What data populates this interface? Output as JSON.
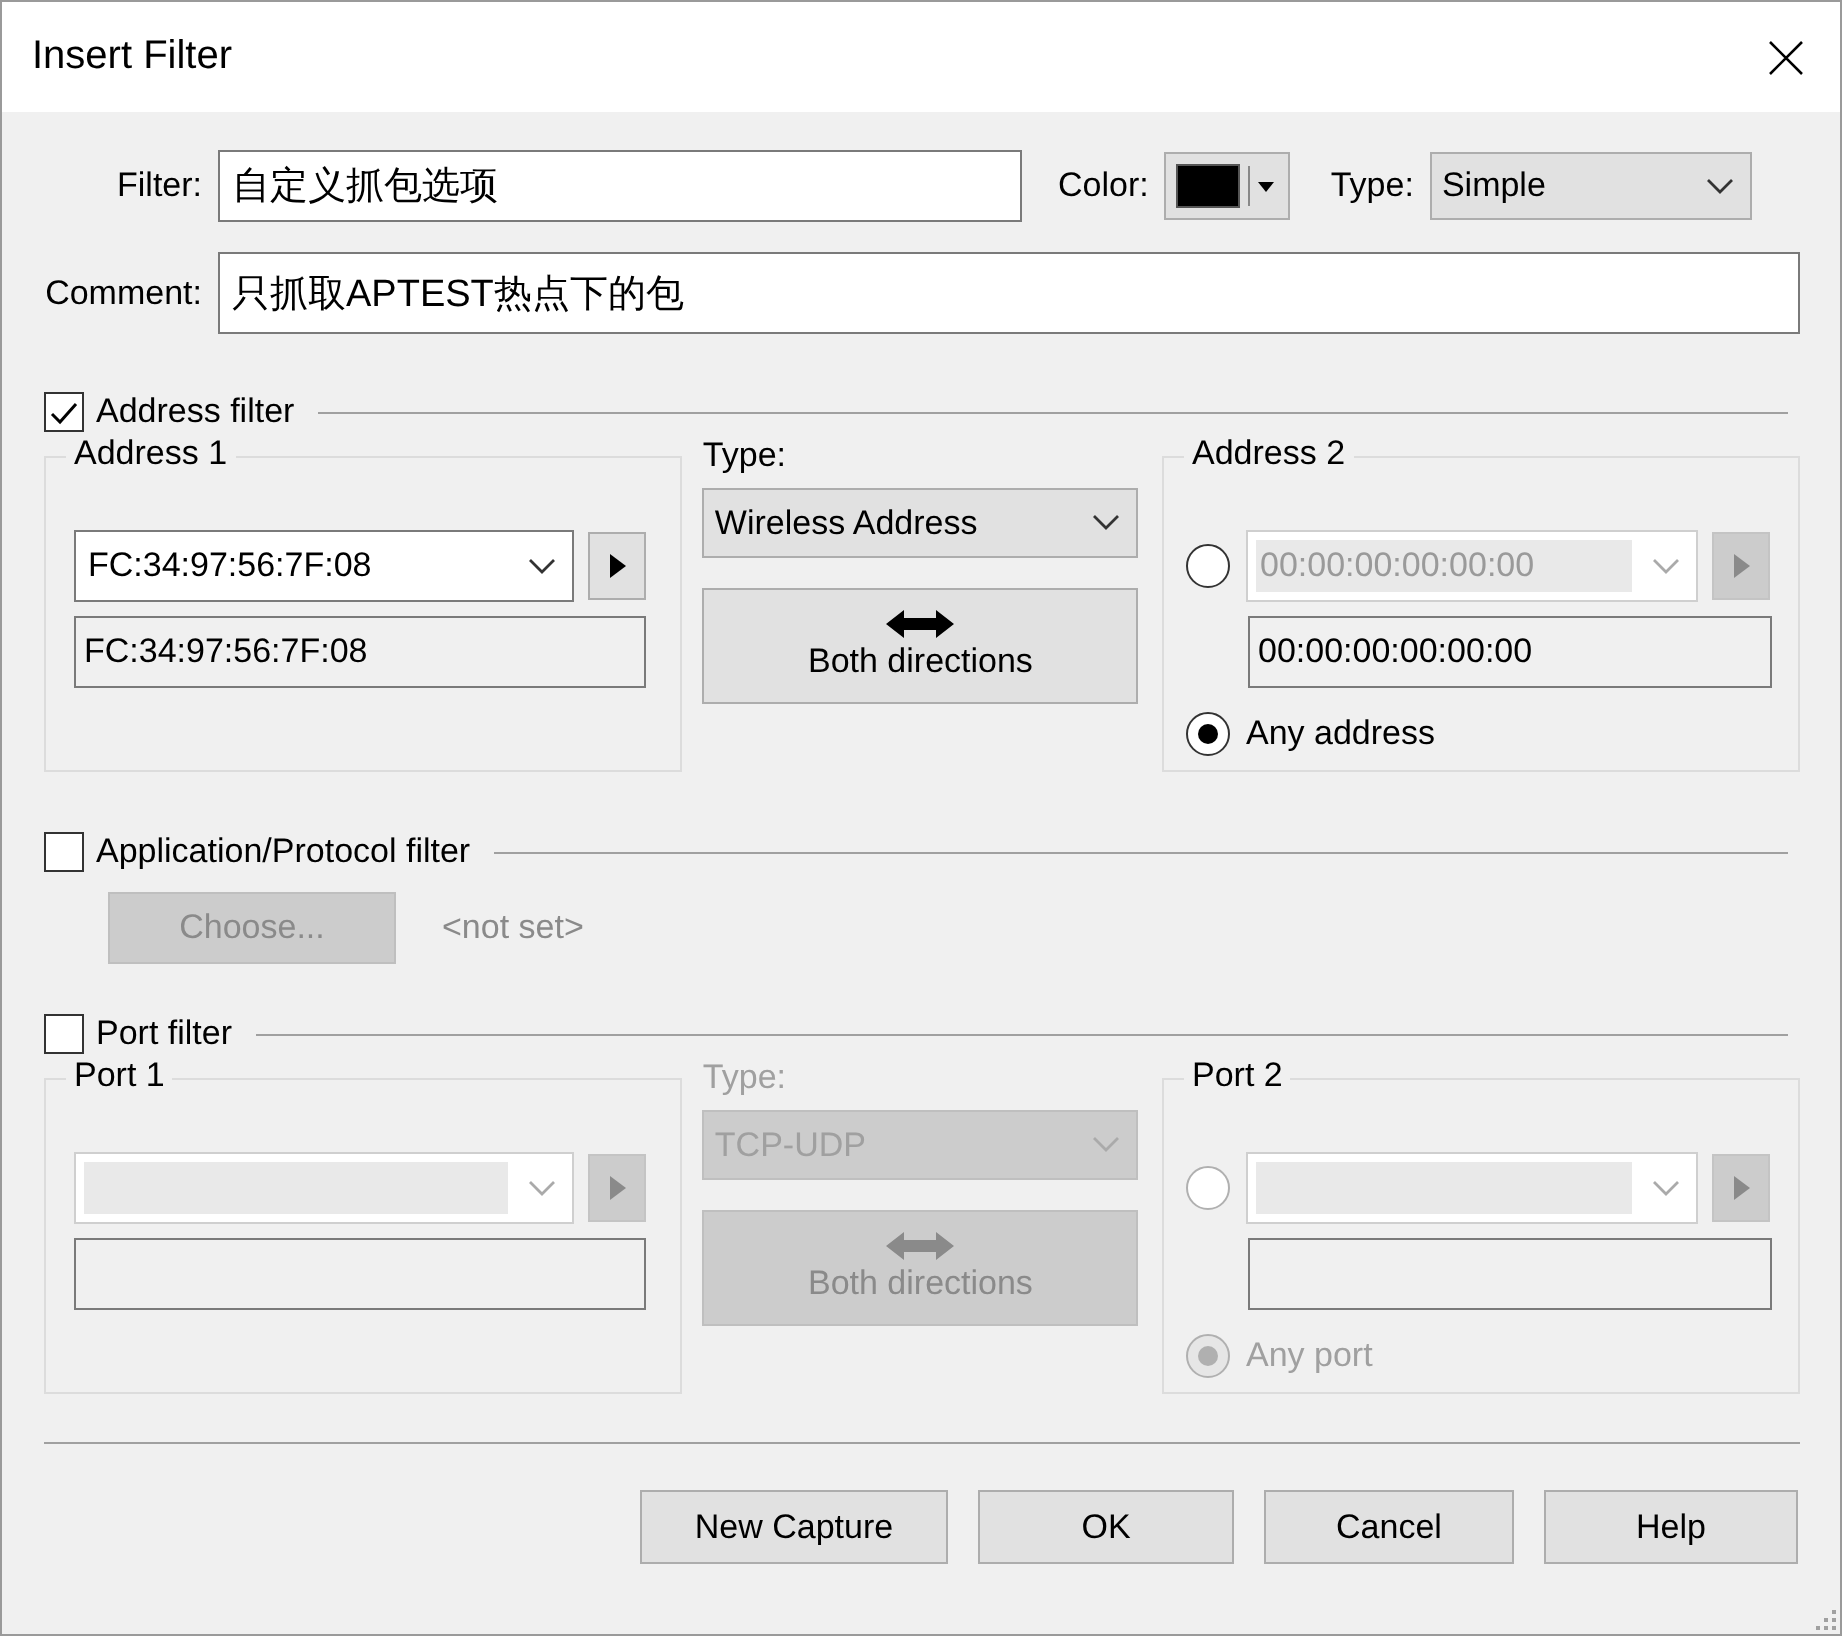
{
  "window": {
    "title": "Insert Filter"
  },
  "filter": {
    "label": "Filter:",
    "value": "自定义抓包选项"
  },
  "color": {
    "label": "Color:",
    "color": "#000000"
  },
  "type": {
    "label": "Type:",
    "value": "Simple"
  },
  "comment": {
    "label": "Comment:",
    "value": "只抓取APTEST热点下的包"
  },
  "address_filter": {
    "label": "Address filter",
    "checked": true,
    "disabled": false,
    "side_1": {
      "title": "Address 1",
      "combo": "FC:34:97:56:7F:08",
      "field": "FC:34:97:56:7F:08"
    },
    "type_label": "Type:",
    "type_value": "Wireless Address",
    "direction": "Both directions",
    "side_2": {
      "title": "Address 2",
      "combo": "00:00:00:00:00:00",
      "field": "00:00:00:00:00:00",
      "options": [
        {
          "selected": false
        },
        {
          "label": "Any address",
          "selected": true
        }
      ]
    }
  },
  "app_filter": {
    "label": "Application/Protocol filter",
    "checked": false,
    "button": "Choose...",
    "value": "<not set>"
  },
  "port_filter": {
    "label": "Port filter",
    "checked": false,
    "disabled": true,
    "side_1": {
      "title": "Port 1"
    },
    "type_label": "Type:",
    "type_value": "TCP-UDP",
    "direction": "Both directions",
    "side_2": {
      "title": "Port 2",
      "options": [
        {
          "selected": false
        },
        {
          "label": "Any port",
          "selected": true
        }
      ]
    }
  },
  "buttons": [
    "New Capture",
    "OK",
    "Cancel",
    "Help"
  ]
}
